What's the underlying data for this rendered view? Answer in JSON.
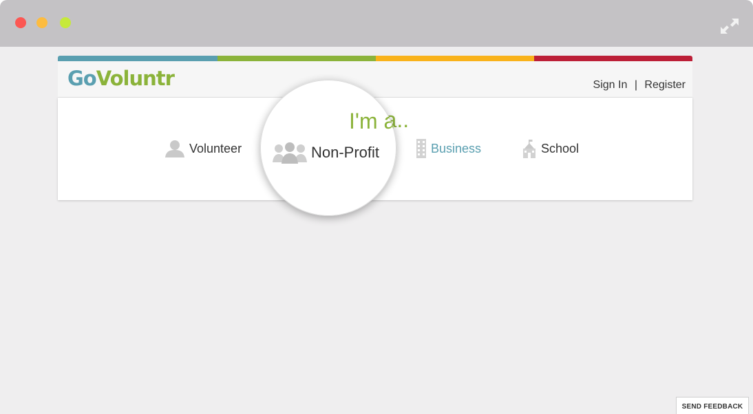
{
  "browser": {
    "traffic_lights": [
      "#fc5753",
      "#fdbc40",
      "#c6e93a"
    ],
    "expand_icon": "expand-arrows-icon"
  },
  "brand": {
    "logo_part1": "Go",
    "logo_part2": "Voluntr",
    "colors": {
      "teal": "#5a9fb0",
      "green": "#8bb33a",
      "yellow": "#f9b21a",
      "red": "#bc1f37"
    }
  },
  "header": {
    "sign_in": "Sign In",
    "separator": "|",
    "register": "Register"
  },
  "chooser": {
    "heading": "I'm a..",
    "options": [
      {
        "label": "Volunteer",
        "icon": "person-icon"
      },
      {
        "label": "Non-Profit",
        "icon": "group-icon"
      },
      {
        "label": "Business",
        "icon": "building-icon"
      },
      {
        "label": "School",
        "icon": "school-icon"
      }
    ]
  },
  "feedback": {
    "label": "SEND FEEDBACK"
  }
}
